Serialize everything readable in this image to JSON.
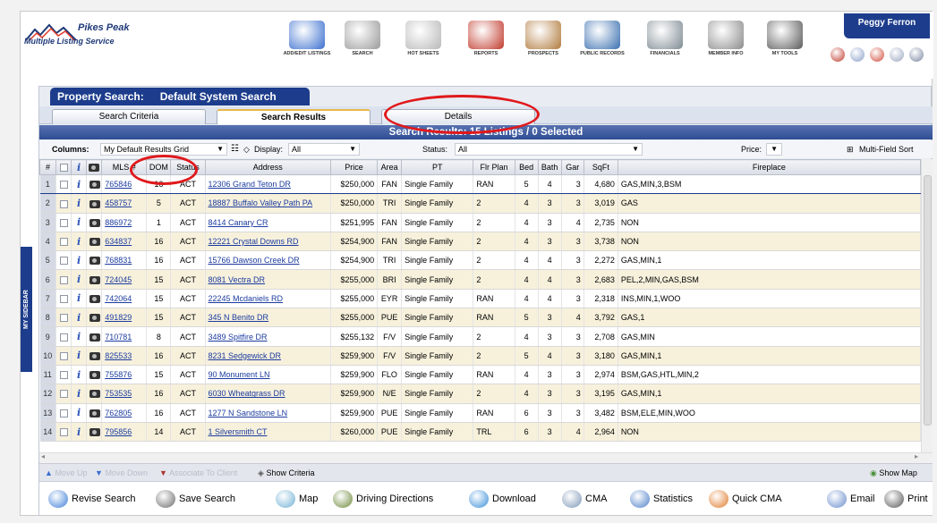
{
  "brand": {
    "line1": "Pikes Peak",
    "line2": "Multiple Listing Service"
  },
  "nav": [
    {
      "label": "ADD/EDIT LISTINGS",
      "icon": "add-edit-listings-icon",
      "color": "#3b6fcf"
    },
    {
      "label": "SEARCH",
      "icon": "magnifier-icon",
      "color": "#9a9a9a"
    },
    {
      "label": "HOT SHEETS",
      "icon": "hot-sheets-icon",
      "color": "#b8b8b8"
    },
    {
      "label": "REPORTS",
      "icon": "reports-icon",
      "color": "#c0392b"
    },
    {
      "label": "PROSPECTS",
      "icon": "prospects-icon",
      "color": "#b07a3c"
    },
    {
      "label": "PUBLIC RECORDS",
      "icon": "public-records-icon",
      "color": "#3a6fb0"
    },
    {
      "label": "FINANCIALS",
      "icon": "calculator-icon",
      "color": "#7d8a92"
    },
    {
      "label": "MEMBER INFO",
      "icon": "member-info-icon",
      "color": "#8a8a8a"
    },
    {
      "label": "MY TOOLS",
      "icon": "tools-icon",
      "color": "#5a5a5a"
    }
  ],
  "user": "Peggy Ferron",
  "quick_icons": [
    "money-icon",
    "envelope-icon",
    "pin-icon",
    "settings-icon",
    "menu-icon"
  ],
  "panel": {
    "title": "Property Search:",
    "subtitle": "Default System Search"
  },
  "tabs": [
    "Search Criteria",
    "Search Results",
    "Details"
  ],
  "status_bar": "Search Results: 15 Listings / 0 Selected",
  "toolbar": {
    "columns_label": "Columns:",
    "columns_value": "My Default Results Grid",
    "display_label": "Display:",
    "display_value": "All",
    "status_label": "Status:",
    "status_value": "All",
    "price_label": "Price:",
    "multisort_label": "Multi-Field Sort"
  },
  "columns": [
    "#",
    "",
    "",
    "",
    "MLS #",
    "DOM",
    "Status",
    "Address",
    "Price",
    "Area",
    "PT",
    "Flr Plan",
    "Bed",
    "Bath",
    "Gar",
    "SqFt",
    "Fireplace"
  ],
  "rows": [
    [
      "1",
      "765846",
      "16",
      "ACT",
      "12306 Grand Teton DR",
      "$250,000",
      "FAN",
      "Single Family",
      "RAN",
      "5",
      "4",
      "3",
      "4,680",
      "GAS,MIN,3,BSM"
    ],
    [
      "2",
      "458757",
      "5",
      "ACT",
      "18887 Buffalo Valley Path PA",
      "$250,000",
      "TRI",
      "Single Family",
      "2",
      "4",
      "3",
      "3",
      "3,019",
      "GAS"
    ],
    [
      "3",
      "886972",
      "1",
      "ACT",
      "8414 Canary CR",
      "$251,995",
      "FAN",
      "Single Family",
      "2",
      "4",
      "3",
      "4",
      "2,735",
      "NON"
    ],
    [
      "4",
      "634837",
      "16",
      "ACT",
      "12221 Crystal Downs RD",
      "$254,900",
      "FAN",
      "Single Family",
      "2",
      "4",
      "3",
      "3",
      "3,738",
      "NON"
    ],
    [
      "5",
      "768831",
      "16",
      "ACT",
      "15766 Dawson Creek DR",
      "$254,900",
      "TRI",
      "Single Family",
      "2",
      "4",
      "4",
      "3",
      "2,272",
      "GAS,MIN,1"
    ],
    [
      "6",
      "724045",
      "15",
      "ACT",
      "8081 Vectra DR",
      "$255,000",
      "BRI",
      "Single Family",
      "2",
      "4",
      "4",
      "3",
      "2,683",
      "PEL,2,MIN,GAS,BSM"
    ],
    [
      "7",
      "742064",
      "15",
      "ACT",
      "22245 Mcdaniels RD",
      "$255,000",
      "EYR",
      "Single Family",
      "RAN",
      "4",
      "4",
      "3",
      "2,318",
      "INS,MIN,1,WOO"
    ],
    [
      "8",
      "491829",
      "15",
      "ACT",
      "345 N Benito DR",
      "$255,000",
      "PUE",
      "Single Family",
      "RAN",
      "5",
      "3",
      "4",
      "3,792",
      "GAS,1"
    ],
    [
      "9",
      "710781",
      "8",
      "ACT",
      "3489 Spitfire DR",
      "$255,132",
      "F/V",
      "Single Family",
      "2",
      "4",
      "3",
      "3",
      "2,708",
      "GAS,MIN"
    ],
    [
      "10",
      "825533",
      "16",
      "ACT",
      "8231 Sedgewick DR",
      "$259,900",
      "F/V",
      "Single Family",
      "2",
      "5",
      "4",
      "3",
      "3,180",
      "GAS,MIN,1"
    ],
    [
      "11",
      "755876",
      "15",
      "ACT",
      "90 Monument LN",
      "$259,900",
      "FLO",
      "Single Family",
      "RAN",
      "4",
      "3",
      "3",
      "2,974",
      "BSM,GAS,HTL,MIN,2"
    ],
    [
      "12",
      "753535",
      "16",
      "ACT",
      "6030 Wheatgrass DR",
      "$259,900",
      "N/E",
      "Single Family",
      "2",
      "4",
      "3",
      "3",
      "3,195",
      "GAS,MIN,1"
    ],
    [
      "13",
      "762805",
      "16",
      "ACT",
      "1277 N Sandstone LN",
      "$259,900",
      "PUE",
      "Single Family",
      "RAN",
      "6",
      "3",
      "3",
      "3,482",
      "BSM,ELE,MIN,WOO"
    ],
    [
      "14",
      "795856",
      "14",
      "ACT",
      "1 Silversmith CT",
      "$260,000",
      "PUE",
      "Single Family",
      "TRL",
      "6",
      "3",
      "4",
      "2,964",
      "NON"
    ]
  ],
  "row_actions": {
    "move_up": "Move Up",
    "move_down": "Move Down",
    "associate": "Associate To Client",
    "show_criteria": "Show Criteria",
    "show_map": "Show Map"
  },
  "actions": [
    {
      "label": "Revise Search",
      "icon": "revise-search-icon",
      "color": "#3f7fd8"
    },
    {
      "label": "Save Search",
      "icon": "save-search-icon",
      "color": "#6b6b6b"
    },
    {
      "label": "Map",
      "icon": "map-icon",
      "color": "#6fb0d4"
    },
    {
      "label": "Driving Directions",
      "icon": "driving-directions-icon",
      "color": "#6d8a3a"
    },
    {
      "label": "Download",
      "icon": "download-icon",
      "color": "#3a8fd8"
    },
    {
      "label": "CMA",
      "icon": "cma-icon",
      "color": "#7d97b7"
    },
    {
      "label": "Statistics",
      "icon": "statistics-icon",
      "color": "#4d7fc8"
    },
    {
      "label": "Quick CMA",
      "icon": "quick-cma-icon",
      "color": "#e07a2a"
    },
    {
      "label": "Email",
      "icon": "email-icon",
      "color": "#6a8ccc"
    },
    {
      "label": "Print",
      "icon": "print-icon",
      "color": "#555"
    }
  ],
  "sidebar_label": "MY SIDEBAR",
  "colors": {
    "brand": "#1d3d8c",
    "row_alt": "#f7f1dc",
    "annotation": "#e0191c",
    "link": "#1c3ca0"
  }
}
